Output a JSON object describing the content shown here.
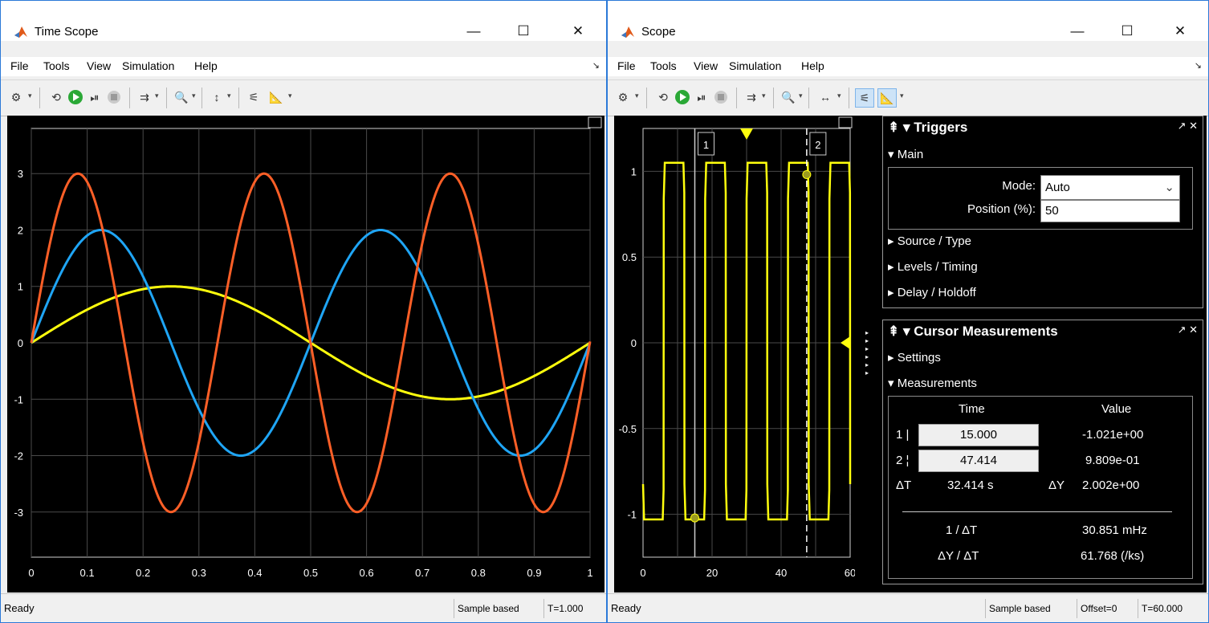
{
  "windows": [
    {
      "title": "Time Scope",
      "menu": [
        "File",
        "Tools",
        "View",
        "Simulation",
        "Help"
      ],
      "status": {
        "ready": "Ready",
        "mode": "Sample based",
        "time": "T=1.000"
      },
      "chart": {
        "x_ticks": [
          "0",
          "0.1",
          "0.2",
          "0.3",
          "0.4",
          "0.5",
          "0.6",
          "0.7",
          "0.8",
          "0.9",
          "1"
        ],
        "y_ticks": [
          "3",
          "2",
          "1",
          "0",
          "-1",
          "-2",
          "-3"
        ]
      }
    },
    {
      "title": "Scope",
      "menu": [
        "File",
        "Tools",
        "View",
        "Simulation",
        "Help"
      ],
      "status": {
        "ready": "Ready",
        "mode": "Sample based",
        "offset": "Offset=0",
        "time": "T=60.000"
      },
      "chart": {
        "x_ticks": [
          "0",
          "20",
          "40",
          "60"
        ],
        "y_ticks": [
          "1",
          "0.5",
          "0",
          "-0.5",
          "-1"
        ],
        "cursor_labels": [
          "1",
          "2"
        ]
      },
      "triggers": {
        "title": "Triggers",
        "main_label": "Main",
        "mode_label": "Mode:",
        "mode_value": "Auto",
        "position_label": "Position (%):",
        "position_value": "50",
        "sections": [
          "Source / Type",
          "Levels / Timing",
          "Delay / Holdoff"
        ]
      },
      "cursor": {
        "title": "Cursor Measurements",
        "settings_label": "Settings",
        "measurements_label": "Measurements",
        "time_header": "Time",
        "value_header": "Value",
        "rows": [
          {
            "label": "1",
            "time": "15.000",
            "value": "-1.021e+00"
          },
          {
            "label": "2",
            "time": "47.414",
            "value": "9.809e-01"
          }
        ],
        "dt_label": "ΔT",
        "dt_value": "32.414 s",
        "dy_label": "ΔY",
        "dy_value": "2.002e+00",
        "inv_dt_label": "1 / ΔT",
        "inv_dt_value": "30.851 mHz",
        "dy_dt_label": "ΔY / ΔT",
        "dy_dt_value": "61.768 (/ks)"
      }
    }
  ],
  "chart_data": [
    {
      "type": "line",
      "xlim": [
        0,
        1
      ],
      "ylim": [
        -3.8,
        3.8
      ],
      "grid": true,
      "x_ticks": [
        0,
        0.1,
        0.2,
        0.3,
        0.4,
        0.5,
        0.6,
        0.7,
        0.8,
        0.9,
        1
      ],
      "y_ticks": [
        -3,
        -2,
        -1,
        0,
        1,
        2,
        3
      ],
      "series": [
        {
          "color": "#ffff0d",
          "x": [
            0,
            0.125,
            0.25,
            0.375,
            0.5,
            0.625,
            0.75,
            0.875,
            1
          ],
          "y": [
            0,
            0.707,
            1,
            0.707,
            0,
            -0.707,
            -1,
            -0.707,
            0
          ]
        },
        {
          "color": "#1fa5f5",
          "x": [
            0,
            0.125,
            0.25,
            0.375,
            0.5,
            0.625,
            0.75,
            0.875,
            1
          ],
          "y": [
            0,
            2,
            0,
            -2,
            0,
            2,
            0,
            -2,
            0
          ]
        },
        {
          "color": "#fd5f27",
          "x": [
            0,
            0.0833,
            0.1667,
            0.25,
            0.3333,
            0.4167,
            0.5,
            0.5833,
            0.6667,
            0.75,
            0.8333,
            0.9167,
            1
          ],
          "y": [
            0,
            3,
            0,
            -3,
            0,
            3,
            0,
            -3,
            0,
            3,
            0,
            -3,
            0
          ]
        }
      ]
    },
    {
      "type": "line",
      "xlim": [
        0,
        60
      ],
      "ylim": [
        -1.25,
        1.25
      ],
      "grid": true,
      "x_ticks": [
        0,
        20,
        40,
        60
      ],
      "y_ticks": [
        -1,
        -0.5,
        0,
        0.5,
        1
      ],
      "series": [
        {
          "color": "#ffff0d",
          "period": 12,
          "high": 1.05,
          "low": -1.03
        }
      ],
      "cursors": [
        15.0,
        47.414
      ],
      "trigger_position": 30,
      "trigger_level": 0
    }
  ]
}
